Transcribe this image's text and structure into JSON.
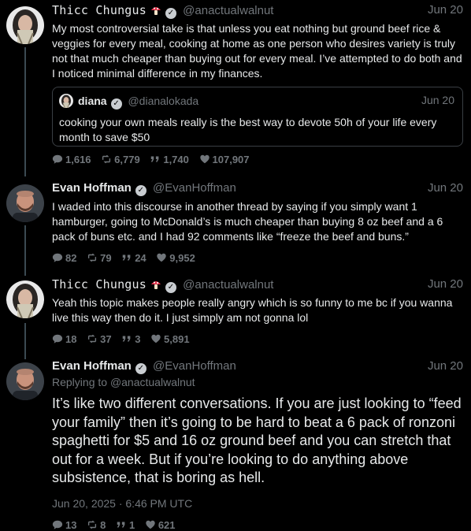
{
  "tweets": [
    {
      "name": "Thicc Chungus",
      "handle": "@anactualwalnut",
      "date": "Jun 20",
      "text": "My most controversial take is that unless you eat nothing but ground beef rice & veggies for every meal, cooking at home as one person who desires variety is truly not that much cheaper than buying out for every meal. I’ve attempted to do both and I noticed minimal difference in my finances.",
      "quote": {
        "name": "diana",
        "handle": "@dianalokada",
        "date": "Jun 20",
        "text": "cooking your own meals really is the best way to devote 50h of your life every month to save $50"
      },
      "stats": {
        "replies": "1,616",
        "retweets": "6,779",
        "quotes": "1,740",
        "likes": "107,907"
      }
    },
    {
      "name": "Evan Hoffman",
      "handle": "@EvanHoffman",
      "date": "Jun 20",
      "text": "I waded into this discourse in another thread by saying if you simply want 1 hamburger, going to McDonald’s is much cheaper than buying 8 oz beef and a 6 pack of buns etc. and I had 92 comments like “freeze the beef and buns.”",
      "stats": {
        "replies": "82",
        "retweets": "79",
        "quotes": "24",
        "likes": "9,952"
      }
    },
    {
      "name": "Thicc Chungus",
      "handle": "@anactualwalnut",
      "date": "Jun 20",
      "text": "Yeah this topic makes people really angry which is so funny to me bc if you wanna live this way then do it. I just simply am not gonna lol",
      "stats": {
        "replies": "18",
        "retweets": "37",
        "quotes": "3",
        "likes": "5,891"
      }
    },
    {
      "name": "Evan Hoffman",
      "handle": "@EvanHoffman",
      "date": "Jun 20",
      "replying_prefix": "Replying to",
      "replying_to": "@anactualwalnut",
      "text": "It’s like two different conversations. If you are just looking to “feed your family” then it’s going to be hard to beat a 6 pack of ronzoni spaghetti for $5 and 16 oz ground beef and you can stretch that out for a week. But if you’re looking to do anything above subsistence, that is boring as hell.",
      "timestamp": "Jun 20, 2025 · 6:46 PM UTC",
      "stats": {
        "replies": "13",
        "retweets": "8",
        "quotes": "1",
        "likes": "621"
      }
    }
  ],
  "colors": {
    "background": "#000000",
    "text": "#e7e9ea",
    "muted": "#71767b",
    "thread_line": "#3b4a52"
  },
  "icons": {
    "reply": "comment-icon",
    "retweet": "retweet-icon",
    "quote": "quote-icon",
    "like": "heart-icon",
    "verified": "verified-badge-icon",
    "emoji": "mushroom-emoji-icon"
  }
}
